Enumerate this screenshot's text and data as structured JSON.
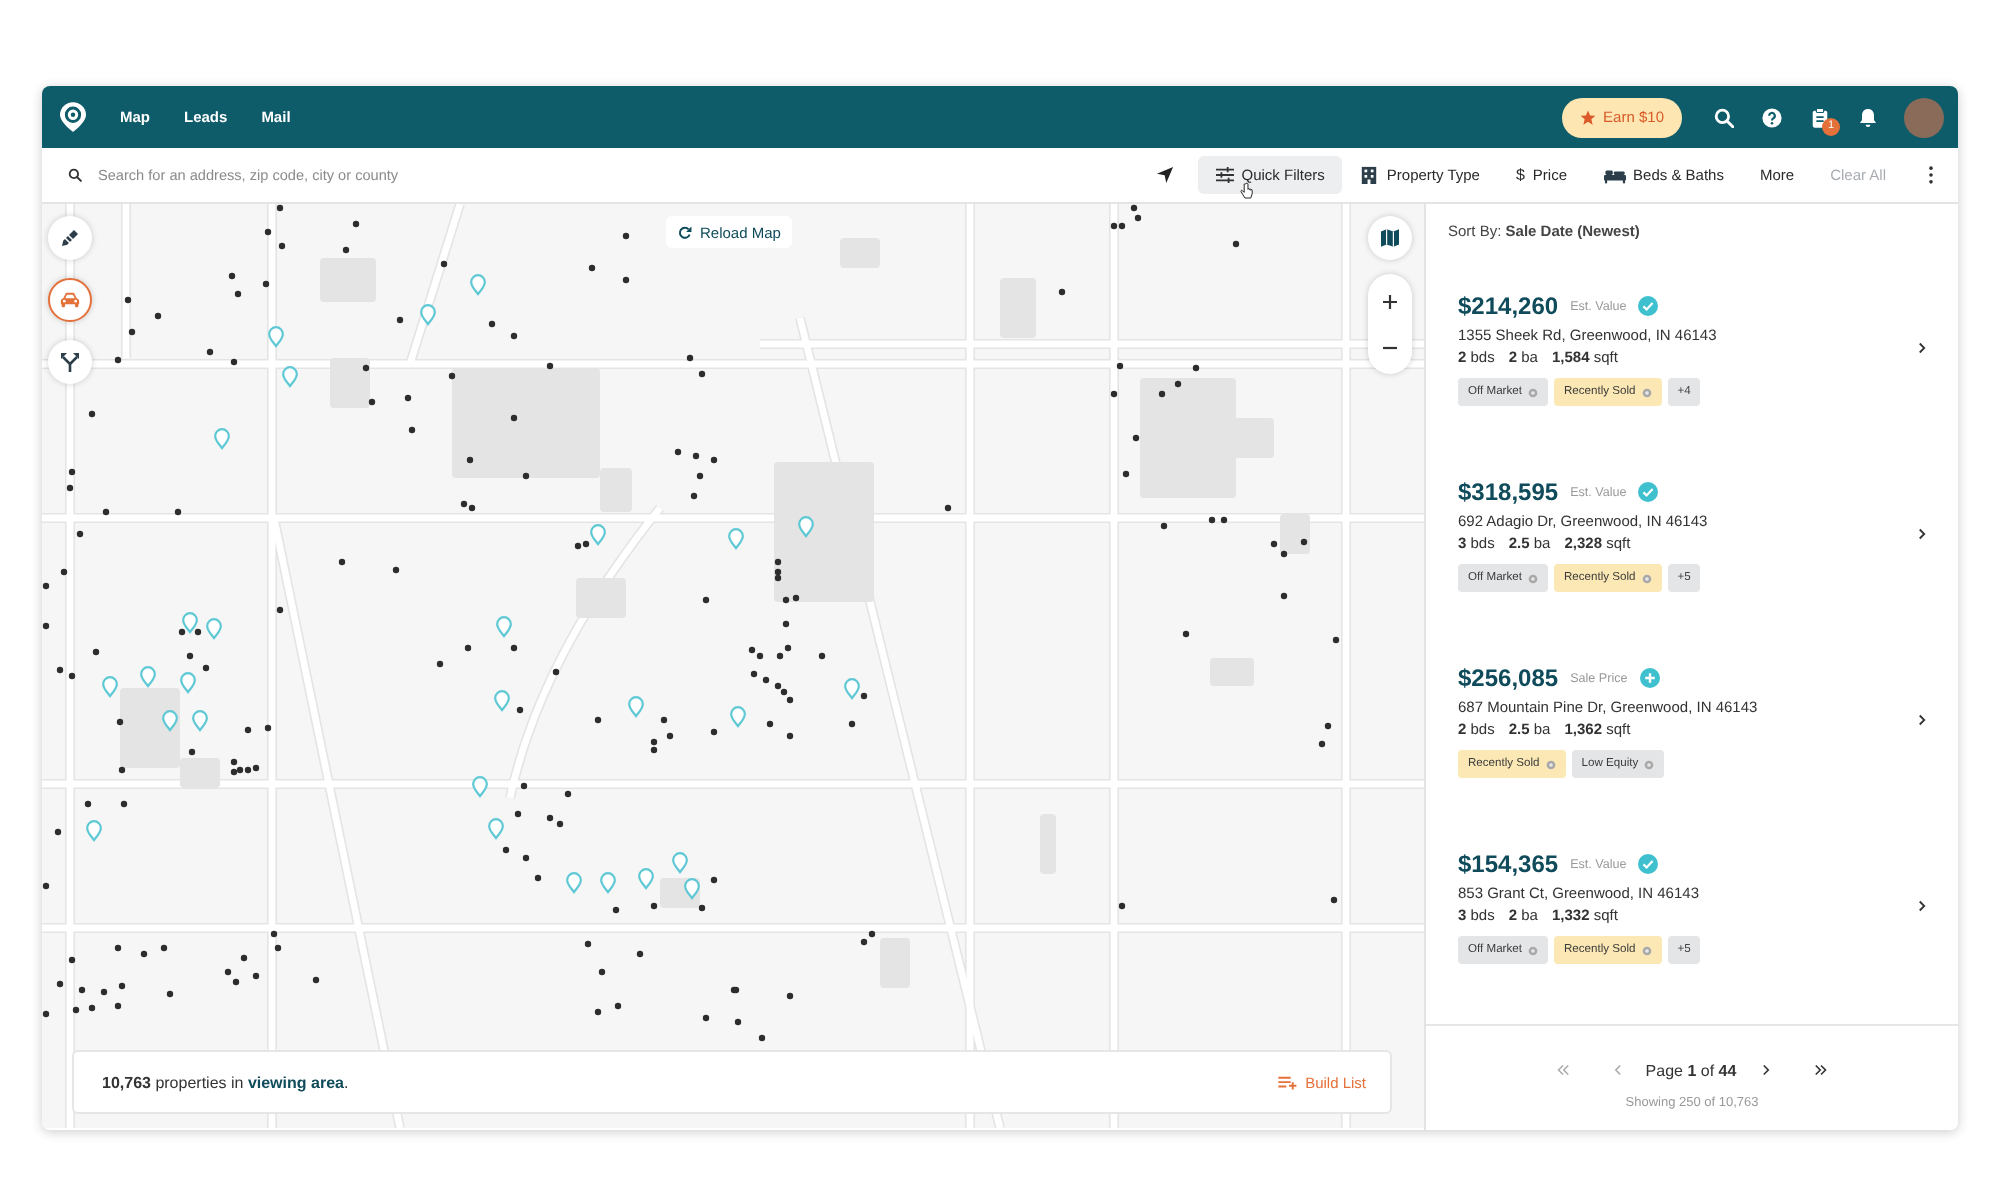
{
  "top_bar": {
    "nav": [
      {
        "label": "Map"
      },
      {
        "label": "Leads"
      },
      {
        "label": "Mail"
      }
    ],
    "earn_button": "Earn $10",
    "tasks_badge": "1"
  },
  "search_bar": {
    "placeholder": "Search for an address, zip code, city or county",
    "filters": [
      {
        "label": "Quick Filters",
        "hovered": true
      },
      {
        "label": "Property Type",
        "hovered": false
      },
      {
        "label": "Price",
        "symbol": "$",
        "hovered": false
      },
      {
        "label": "Beds & Baths",
        "hovered": false
      }
    ],
    "more": "More",
    "clear": {
      "label": "Clear All",
      "disabled": true
    }
  },
  "map": {
    "tools": [
      {
        "selected": false
      },
      {
        "selected": true
      },
      {
        "selected": false
      }
    ],
    "reload_button": "Reload Map",
    "summary": {
      "before": "**10,763** properties in ",
      "link": "viewing area",
      "after": "."
    },
    "build_list_button": "Build List"
  },
  "results": {
    "sort_label": "Sort By: **Sale Date (Newest)**",
    "listings": [
      {
        "price": "$214,260",
        "price_label": "Est. Value",
        "verified": true,
        "address": "1355 Sheek Rd, Greenwood, IN 46143",
        "stats": [
          "**2** bds",
          "**2** ba",
          "**1,584** sqft"
        ],
        "tags": [
          {
            "label": "Off Market",
            "color": "#e4e5e7"
          },
          {
            "label": "Recently Sold",
            "color": "#fbe8b4"
          }
        ],
        "more": "+4"
      },
      {
        "price": "$318,595",
        "price_label": "Est. Value",
        "verified": true,
        "address": "692 Adagio Dr, Greenwood, IN 46143",
        "stats": [
          "**3** bds",
          "**2.5** ba",
          "**2,328** sqft"
        ],
        "tags": [
          {
            "label": "Off Market",
            "color": "#e4e5e7"
          },
          {
            "label": "Recently Sold",
            "color": "#fbe8b4"
          }
        ],
        "more": "+5"
      },
      {
        "price": "$256,085",
        "price_label": "Sale Price",
        "verified": false,
        "address": "687 Mountain Pine Dr, Greenwood, IN 46143",
        "stats": [
          "**2** bds",
          "**2.5** ba",
          "**1,362** sqft"
        ],
        "tags": [
          {
            "label": "Recently Sold",
            "color": "#fbe8b4"
          },
          {
            "label": "Low Equity",
            "color": "#e4e5e7"
          }
        ]
      },
      {
        "price": "$154,365",
        "price_label": "Est. Value",
        "verified": true,
        "address": "853 Grant Ct, Greenwood, IN 46143",
        "stats": [
          "**3** bds",
          "**2** ba",
          "**1,332** sqft"
        ],
        "tags": [
          {
            "label": "Off Market",
            "color": "#e4e5e7"
          },
          {
            "label": "Recently Sold",
            "color": "#fbe8b4"
          }
        ],
        "more": "+5"
      }
    ],
    "pagination": {
      "first": {
        "disabled": true
      },
      "prev": {
        "disabled": true
      },
      "label": "Page **1** of **44**",
      "next": {
        "disabled": false
      },
      "last": {
        "disabled": false
      },
      "showing": "Showing 250 of 10,763"
    }
  }
}
